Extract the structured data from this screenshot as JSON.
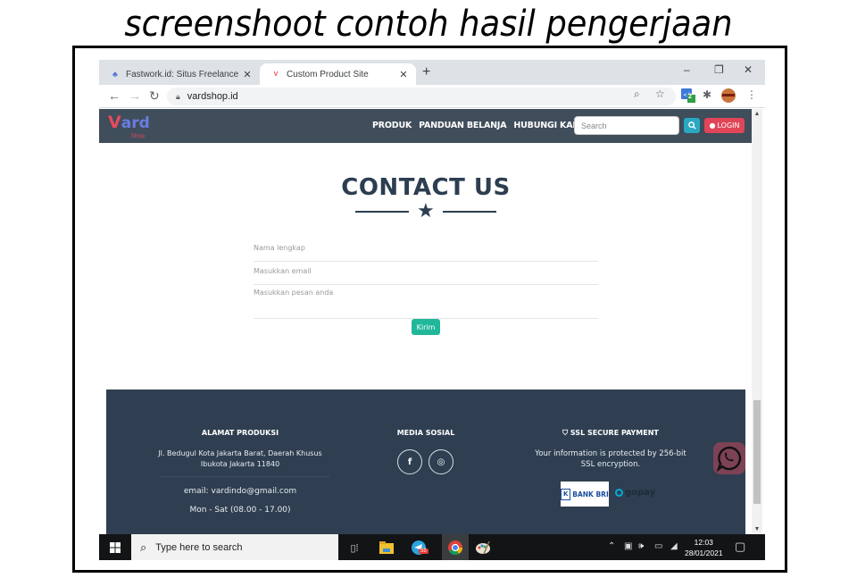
{
  "caption": "screenshoot contoh hasil pengerjaan",
  "browser": {
    "tabs": [
      {
        "label": "Fastwork.id: Situs Freelance Online",
        "active": false,
        "icon": "fastwork-icon"
      },
      {
        "label": "Custom Product Site",
        "active": true,
        "icon": "vard-favicon"
      }
    ],
    "new_tab": "+",
    "url": "vardshop.id",
    "extension_badge": "2",
    "window_controls": {
      "minimize": "–",
      "restore": "❐",
      "close": "✕"
    }
  },
  "site": {
    "logo": {
      "main_first": "V",
      "main_rest": "ard",
      "sub": "Shop"
    },
    "menu": [
      "PRODUK",
      "PANDUAN BELANJA",
      "HUBUNGI KAMI"
    ],
    "search_placeholder": "Search",
    "login_label": "LOGIN",
    "colors": {
      "nav": "#404d5b",
      "accent_teal": "#29a8c1",
      "accent_red": "#e04658",
      "submit": "#20b79a",
      "footer": "#2f3f51",
      "heading": "#2c3e50"
    }
  },
  "contact": {
    "title": "CONTACT US",
    "fields": {
      "name_placeholder": "Nama lengkap",
      "email_placeholder": "Masukkan email",
      "message_placeholder": "Masukkan pesan anda"
    },
    "submit_label": "Kirim"
  },
  "footer": {
    "address": {
      "heading": "ALAMAT PRODUKSI",
      "line1": "Jl. Bedugul Kota Jakarta Barat, Daerah Khusus",
      "line2": "Ibukota Jakarta 11840",
      "email": "email: vardindo@gmail.com",
      "hours": "Mon - Sat (08.00 - 17.00)"
    },
    "social": {
      "heading": "MEDIA SOSIAL",
      "items": [
        {
          "name": "facebook",
          "glyph": "f"
        },
        {
          "name": "instagram",
          "glyph": "◎"
        }
      ]
    },
    "payment": {
      "heading": "SSL SECURE PAYMENT",
      "text1": "Your information is protected by 256-bit",
      "text2": "SSL encryption.",
      "bank": "BANK BRI",
      "wallet": "gopay"
    }
  },
  "taskbar": {
    "search_placeholder": "Type here to search",
    "telegram_badge": "55",
    "time": "12:03",
    "date": "28/01/2021"
  }
}
